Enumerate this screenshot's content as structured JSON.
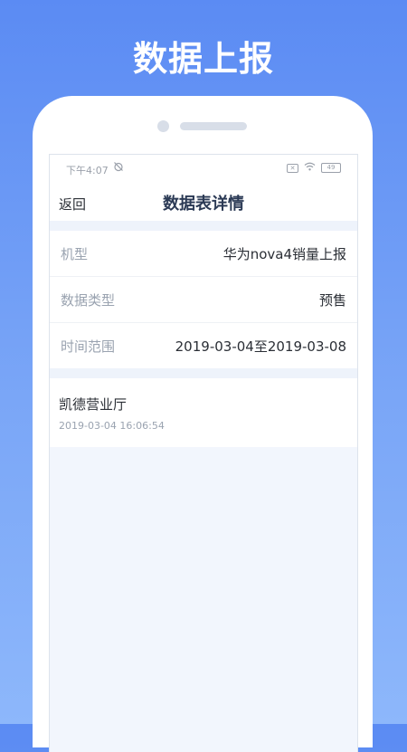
{
  "promo": {
    "title": "数据上报"
  },
  "status_bar": {
    "time": "下午4:07",
    "battery": "49"
  },
  "nav": {
    "back_label": "返回",
    "title": "数据表详情"
  },
  "details": [
    {
      "label": "机型",
      "value": "华为nova4销量上报"
    },
    {
      "label": "数据类型",
      "value": "预售"
    },
    {
      "label": "时间范围",
      "value": "2019-03-04至2019-03-08"
    }
  ],
  "records": [
    {
      "name": "凯德营业厅",
      "time": "2019-03-04 16:06:54"
    }
  ],
  "icons": {
    "status_left": "alarm-off-icon",
    "status_right": [
      "sim-off-icon",
      "wifi-icon",
      "battery-icon"
    ]
  }
}
